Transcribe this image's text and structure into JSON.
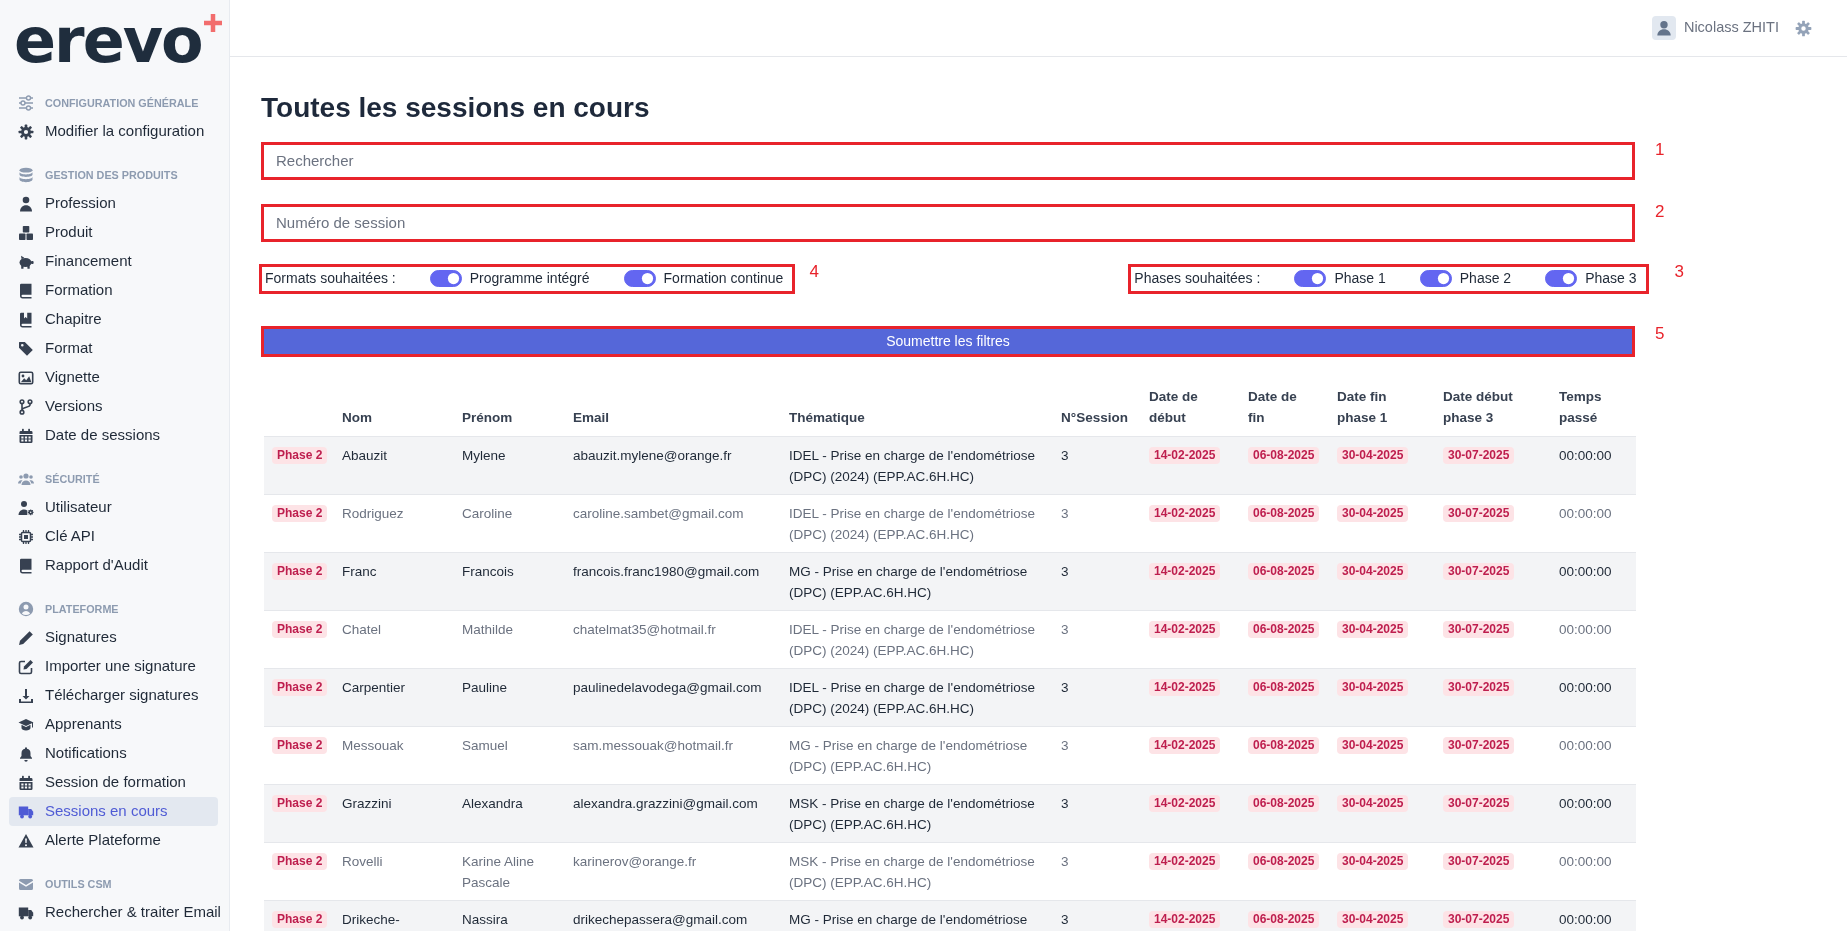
{
  "sidebar": {
    "logo": "erevo",
    "sections": [
      {
        "title": "CONFIGURATION GÉNÉRALE",
        "items": [
          {
            "label": "Modifier la configuration",
            "selected": false
          }
        ]
      },
      {
        "title": "GESTION DES PRODUITS",
        "items": [
          {
            "label": "Profession",
            "selected": false
          },
          {
            "label": "Produit",
            "selected": false
          },
          {
            "label": "Financement",
            "selected": false
          },
          {
            "label": "Formation",
            "selected": false
          },
          {
            "label": "Chapitre",
            "selected": false
          },
          {
            "label": "Format",
            "selected": false
          },
          {
            "label": "Vignette",
            "selected": false
          },
          {
            "label": "Versions",
            "selected": false
          },
          {
            "label": "Date de sessions",
            "selected": false
          }
        ]
      },
      {
        "title": "SÉCURITÉ",
        "items": [
          {
            "label": "Utilisateur",
            "selected": false
          },
          {
            "label": "Clé API",
            "selected": false
          },
          {
            "label": "Rapport d'Audit",
            "selected": false
          }
        ]
      },
      {
        "title": "PLATEFORME",
        "items": [
          {
            "label": "Signatures",
            "selected": false
          },
          {
            "label": "Importer une signature",
            "selected": false
          },
          {
            "label": "Télécharger signatures",
            "selected": false
          },
          {
            "label": "Apprenants",
            "selected": false
          },
          {
            "label": "Notifications",
            "selected": false
          },
          {
            "label": "Session de formation",
            "selected": false
          },
          {
            "label": "Sessions en cours",
            "selected": true
          },
          {
            "label": "Alerte Plateforme",
            "selected": false
          }
        ]
      },
      {
        "title": "OUTILS CSM",
        "items": [
          {
            "label": "Rechercher & traiter Email",
            "selected": false
          }
        ]
      }
    ]
  },
  "topbar": {
    "user_name": "Nicolass ZHITI"
  },
  "page_title": "Toutes les sessions en cours",
  "search": {
    "placeholder": "Rechercher",
    "annotation": "1"
  },
  "session_number": {
    "placeholder": "Numéro de session",
    "annotation": "2"
  },
  "formats": {
    "label": "Formats souhaitées :",
    "annotation": "4",
    "options": [
      {
        "label": "Programme intégré",
        "on": true
      },
      {
        "label": "Formation continue",
        "on": true
      }
    ]
  },
  "phases": {
    "label": "Phases souhaitées :",
    "annotation": "3",
    "options": [
      {
        "label": "Phase 1",
        "on": true
      },
      {
        "label": "Phase 2",
        "on": true
      },
      {
        "label": "Phase 3",
        "on": true
      }
    ]
  },
  "submit_button": {
    "label": "Soumettre les filtres",
    "annotation": "5"
  },
  "table": {
    "columns": [
      "Nom",
      "Prénom",
      "Email",
      "Thématique",
      "N°Session",
      "Date de début",
      "Date de fin",
      "Date fin phase 1",
      "Date début phase 3",
      "Temps passé"
    ],
    "rows": [
      {
        "phase": "Phase 2",
        "last_name": "Abauzit",
        "first_name": "Mylene",
        "email": "abauzit.mylene@orange.fr",
        "theme": "IDEL - Prise en charge de l'endométriose (DPC) (2024) (EPP.AC.6H.HC)",
        "session": "3",
        "start_date": "14-02-2025",
        "end_date": "06-08-2025",
        "phase_1_end": "30-04-2025",
        "phase_3_start": "30-07-2025",
        "time_spent": "00:00:00"
      },
      {
        "phase": "Phase 2",
        "last_name": "Rodriguez",
        "first_name": "Caroline",
        "email": "caroline.sambet@gmail.com",
        "theme": "IDEL - Prise en charge de l'endométriose (DPC) (2024) (EPP.AC.6H.HC)",
        "session": "3",
        "start_date": "14-02-2025",
        "end_date": "06-08-2025",
        "phase_1_end": "30-04-2025",
        "phase_3_start": "30-07-2025",
        "time_spent": "00:00:00"
      },
      {
        "phase": "Phase 2",
        "last_name": "Franc",
        "first_name": "Francois",
        "email": "francois.franc1980@gmail.com",
        "theme": "MG - Prise en charge de l'endométriose (DPC) (EPP.AC.6H.HC)",
        "session": "3",
        "start_date": "14-02-2025",
        "end_date": "06-08-2025",
        "phase_1_end": "30-04-2025",
        "phase_3_start": "30-07-2025",
        "time_spent": "00:00:00"
      },
      {
        "phase": "Phase 2",
        "last_name": "Chatel",
        "first_name": "Mathilde",
        "email": "chatelmat35@hotmail.fr",
        "theme": "IDEL - Prise en charge de l'endométriose (DPC) (2024) (EPP.AC.6H.HC)",
        "session": "3",
        "start_date": "14-02-2025",
        "end_date": "06-08-2025",
        "phase_1_end": "30-04-2025",
        "phase_3_start": "30-07-2025",
        "time_spent": "00:00:00"
      },
      {
        "phase": "Phase 2",
        "last_name": "Carpentier",
        "first_name": "Pauline",
        "email": "paulinedelavodega@gmail.com",
        "theme": "IDEL - Prise en charge de l'endométriose (DPC) (2024) (EPP.AC.6H.HC)",
        "session": "3",
        "start_date": "14-02-2025",
        "end_date": "06-08-2025",
        "phase_1_end": "30-04-2025",
        "phase_3_start": "30-07-2025",
        "time_spent": "00:00:00"
      },
      {
        "phase": "Phase 2",
        "last_name": "Messouak",
        "first_name": "Samuel",
        "email": "sam.messouak@hotmail.fr",
        "theme": "MG - Prise en charge de l'endométriose (DPC) (EPP.AC.6H.HC)",
        "session": "3",
        "start_date": "14-02-2025",
        "end_date": "06-08-2025",
        "phase_1_end": "30-04-2025",
        "phase_3_start": "30-07-2025",
        "time_spent": "00:00:00"
      },
      {
        "phase": "Phase 2",
        "last_name": "Grazzini",
        "first_name": "Alexandra",
        "email": "alexandra.grazzini@gmail.com",
        "theme": "MSK - Prise en charge de l'endométriose (DPC) (EPP.AC.6H.HC)",
        "session": "3",
        "start_date": "14-02-2025",
        "end_date": "06-08-2025",
        "phase_1_end": "30-04-2025",
        "phase_3_start": "30-07-2025",
        "time_spent": "00:00:00"
      },
      {
        "phase": "Phase 2",
        "last_name": "Rovelli",
        "first_name": "Karine Aline Pascale",
        "email": "karinerov@orange.fr",
        "theme": "MSK - Prise en charge de l'endométriose (DPC) (EPP.AC.6H.HC)",
        "session": "3",
        "start_date": "14-02-2025",
        "end_date": "06-08-2025",
        "phase_1_end": "30-04-2025",
        "phase_3_start": "30-07-2025",
        "time_spent": "00:00:00"
      },
      {
        "phase": "Phase 2",
        "last_name": "Drikeche-",
        "first_name": "Nassira",
        "email": "drikechepassera@gmail.com",
        "theme": "MG - Prise en charge de l'endométriose",
        "session": "3",
        "start_date": "14-02-2025",
        "end_date": "06-08-2025",
        "phase_1_end": "30-04-2025",
        "phase_3_start": "30-07-2025",
        "time_spent": "00:00:00"
      }
    ]
  }
}
